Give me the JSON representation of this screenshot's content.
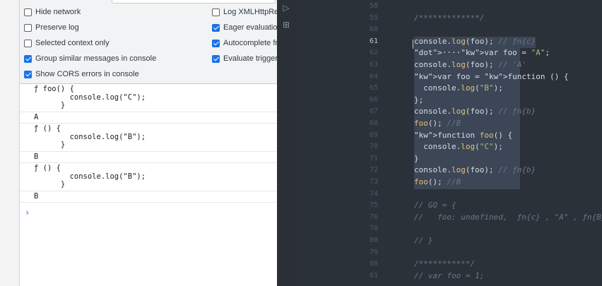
{
  "settings": {
    "left": [
      {
        "label": "Hide network",
        "checked": false
      },
      {
        "label": "Preserve log",
        "checked": false
      },
      {
        "label": "Selected context only",
        "checked": false
      },
      {
        "label": "Group similar messages in console",
        "checked": true
      },
      {
        "label": "Show CORS errors in console",
        "checked": true
      }
    ],
    "right": [
      {
        "label": "Log XMLHttpReq",
        "checked": false
      },
      {
        "label": "Eager evaluation",
        "checked": true
      },
      {
        "label": "Autocomplete fro",
        "checked": true
      },
      {
        "label": "Evaluate triggers",
        "checked": true
      }
    ]
  },
  "console": {
    "entries": [
      "ƒ foo() {\n        console.log(\"C\");\n      }",
      "A",
      "ƒ () {\n        console.log(\"B\");\n      }",
      "B",
      "ƒ () {\n        console.log(\"B\");\n      }",
      "B"
    ],
    "prompt": "›"
  },
  "sidebar_icons": [
    "play-debug-icon",
    "extensions-icon"
  ],
  "editor": {
    "active_line": 61,
    "lines": [
      {
        "n": "58",
        "text": ""
      },
      {
        "n": "59",
        "text": "/*************/"
      },
      {
        "n": "60",
        "text": ""
      },
      {
        "n": "61",
        "text": "console.log(foo); // ƒn{c}"
      },
      {
        "n": "62",
        "text": "····var foo = \"A\";"
      },
      {
        "n": "63",
        "text": "console.log(foo); // 'A'"
      },
      {
        "n": "64",
        "text": "var foo = function () {"
      },
      {
        "n": "65",
        "text": "  console.log(\"B\");"
      },
      {
        "n": "66",
        "text": "};"
      },
      {
        "n": "67",
        "text": "console.log(foo); // ƒn{b}"
      },
      {
        "n": "68",
        "text": "foo(); //B"
      },
      {
        "n": "69",
        "text": "function foo() {"
      },
      {
        "n": "70",
        "text": "  console.log(\"C\");"
      },
      {
        "n": "71",
        "text": "}"
      },
      {
        "n": "72",
        "text": "console.log(foo); // ƒn{b}"
      },
      {
        "n": "73",
        "text": "foo(); //B"
      },
      {
        "n": "74",
        "text": ""
      },
      {
        "n": "75",
        "text": "// GO = {"
      },
      {
        "n": "76",
        "text": "//   foo: undefined,  ƒn{c} , \"A\" , ƒn{B}"
      },
      {
        "n": "78",
        "text": ""
      },
      {
        "n": "80",
        "text": "// }"
      },
      {
        "n": "79",
        "text": ""
      },
      {
        "n": "80",
        "text": "/***********/"
      },
      {
        "n": "81",
        "text": "// var foo = 1;"
      }
    ]
  }
}
